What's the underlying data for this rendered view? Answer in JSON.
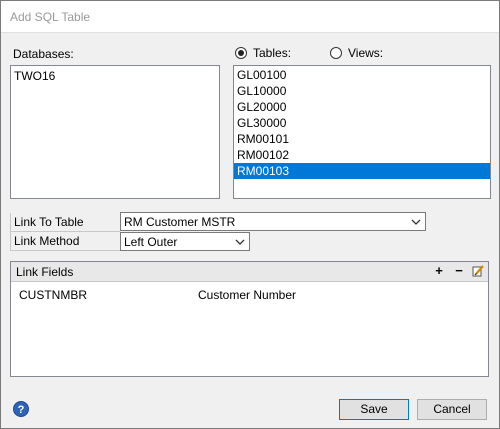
{
  "window": {
    "title": "Add SQL Table"
  },
  "databases": {
    "label": "Databases:",
    "items": [
      "TWO16"
    ]
  },
  "object_type": {
    "tables_label": "Tables:",
    "views_label": "Views:",
    "selected": "Tables"
  },
  "tables": {
    "items": [
      "GL00100",
      "GL10000",
      "GL20000",
      "GL30000",
      "RM00101",
      "RM00102",
      "RM00103"
    ],
    "selected": "RM00103"
  },
  "link_to_table": {
    "label": "Link To Table",
    "value": "RM Customer MSTR"
  },
  "link_method": {
    "label": "Link Method",
    "value": "Left Outer"
  },
  "link_fields": {
    "title": "Link Fields",
    "rows": [
      {
        "field": "CUSTNMBR",
        "description": "Customer Number"
      }
    ]
  },
  "buttons": {
    "save": "Save",
    "cancel": "Cancel"
  },
  "help_glyph": "?",
  "tool_glyphs": {
    "add": "+",
    "remove": "−"
  }
}
